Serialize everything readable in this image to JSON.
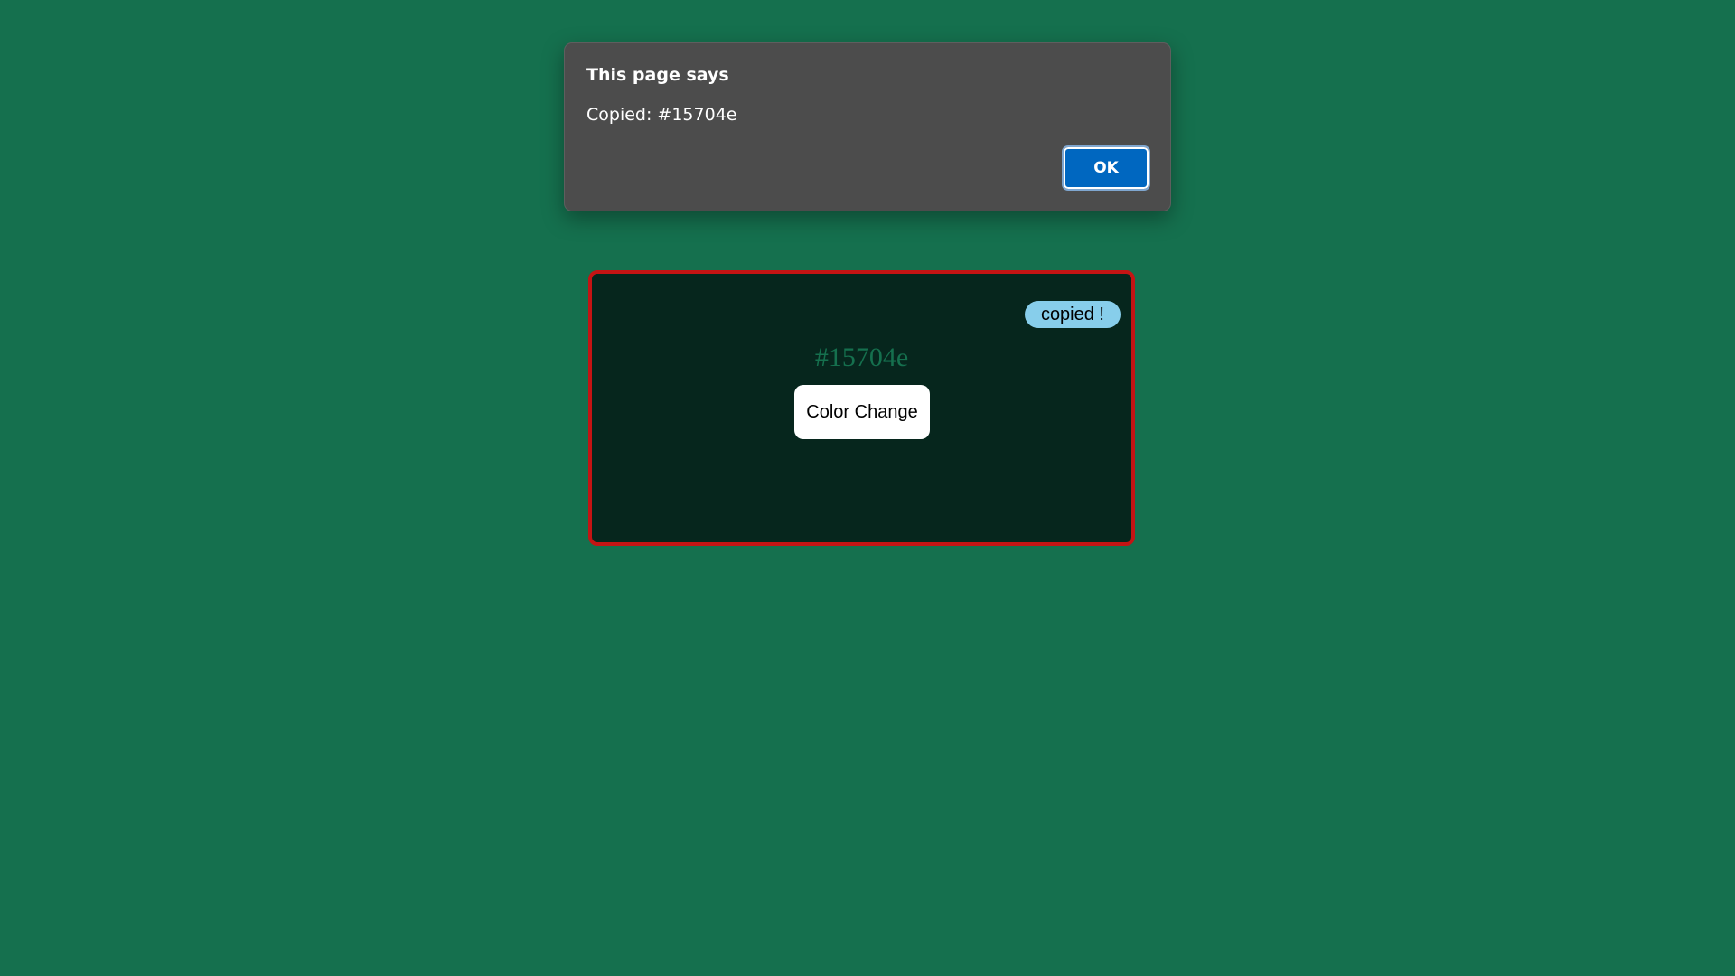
{
  "page": {
    "background_color": "#15704e"
  },
  "alert": {
    "title": "This page says",
    "message": "Copied: #15704e",
    "ok_label": "OK"
  },
  "card": {
    "copied_badge": "copied !",
    "color_code": "#15704e",
    "button_label": "Color Change",
    "border_color": "#c41414",
    "background_color": "#06261d"
  }
}
